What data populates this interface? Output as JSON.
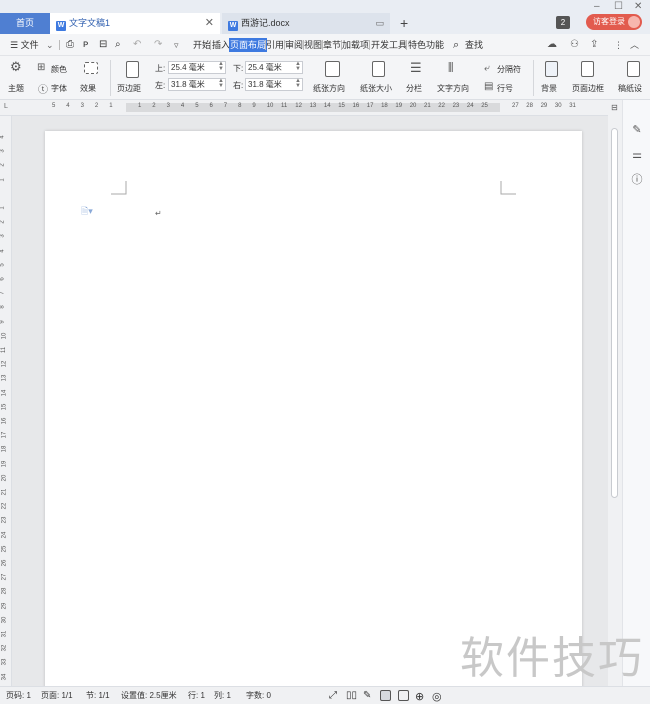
{
  "window": {
    "minimize": "–",
    "maximize": "☐",
    "close": "✕"
  },
  "tabs": {
    "home": "首页",
    "doc1": "文字文稿1",
    "doc2": "西游记.docx",
    "add": "+",
    "doc_icon_letter": "W"
  },
  "account": {
    "count_badge": "2",
    "login": "访客登录"
  },
  "menu": {
    "file": "☰ 文件",
    "file_caret": "⌄",
    "items": [
      "开始",
      "插入",
      "页面布局",
      "引用",
      "审阅",
      "视图",
      "章节",
      "加载项",
      "开发工具",
      "特色功能"
    ],
    "active_index": 2,
    "search": "查找"
  },
  "ribbon": {
    "theme": "主题",
    "color": "颜色",
    "font": "字体",
    "effect": "效果",
    "margins": "页边距",
    "top_label": "上:",
    "top_value": "25.4 毫米",
    "bottom_label": "下:",
    "bottom_value": "25.4 毫米",
    "left_label": "左:",
    "left_value": "31.8 毫米",
    "right_label": "右:",
    "right_value": "31.8 毫米",
    "orientation": "纸张方向",
    "size": "纸张大小",
    "columns": "分栏",
    "text_direction": "文字方向",
    "break": "分隔符",
    "line_numbers": "行号",
    "background": "背景",
    "page_border": "页面边框",
    "manuscript": "稿纸设"
  },
  "ruler": {
    "h_left": [
      "5",
      "4",
      "3",
      "2",
      "1"
    ],
    "h_right": [
      "1",
      "2",
      "3",
      "4",
      "5",
      "6",
      "7",
      "8",
      "9",
      "10",
      "11",
      "12",
      "13",
      "14",
      "15",
      "16",
      "17",
      "18",
      "19",
      "20",
      "21",
      "22",
      "23",
      "24",
      "25"
    ],
    "h_tail": [
      "27",
      "28",
      "29",
      "30",
      "31"
    ],
    "v": [
      "4",
      "3",
      "2",
      "1",
      "",
      "1",
      "2",
      "3",
      "4",
      "5",
      "6",
      "7",
      "8",
      "9",
      "10",
      "11",
      "12",
      "13",
      "14",
      "15",
      "16",
      "17",
      "18",
      "19",
      "20",
      "21",
      "22",
      "23",
      "24",
      "25",
      "26",
      "27",
      "28",
      "29",
      "30",
      "31",
      "32",
      "33",
      "34"
    ]
  },
  "status": {
    "page_code": "页码: 1",
    "pages": "页面: 1/1",
    "section": "节: 1/1",
    "position": "设置值: 2.5厘米",
    "row": "行: 1",
    "col": "列: 1",
    "words": "字数: 0"
  },
  "watermark": "软件技巧"
}
